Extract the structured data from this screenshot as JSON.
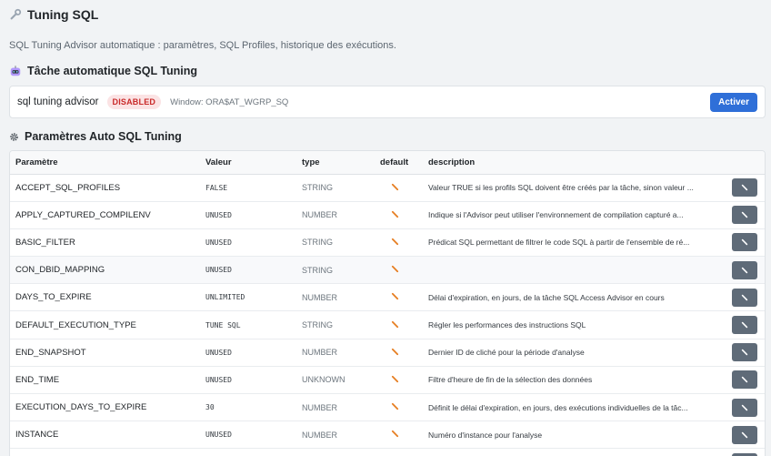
{
  "page": {
    "title": "Tuning SQL",
    "title_icon": "wrench-icon",
    "subtitle": "SQL Tuning Advisor automatique : paramètres, SQL Profiles, historique des exécutions."
  },
  "task_section": {
    "title": "Tâche automatique SQL Tuning",
    "icon": "robot-icon",
    "task_name": "sql tuning advisor",
    "status": "DISABLED",
    "window": "Window: ORA$AT_WGRP_SQ",
    "activate_label": "Activer"
  },
  "params_section": {
    "title": "Paramètres Auto SQL Tuning",
    "icon": "gear-icon",
    "columns": [
      "Paramètre",
      "Valeur",
      "type",
      "default",
      "description"
    ],
    "rows": [
      {
        "name": "ACCEPT_SQL_PROFILES",
        "value": "FALSE",
        "type": "STRING",
        "description": "Valeur TRUE si les profils SQL doivent être créés par la tâche, sinon valeur ..."
      },
      {
        "name": "APPLY_CAPTURED_COMPILENV",
        "value": "UNUSED",
        "type": "NUMBER",
        "description": "Indique si l'Advisor peut utiliser l'environnement de compilation capturé a..."
      },
      {
        "name": "BASIC_FILTER",
        "value": "UNUSED",
        "type": "STRING",
        "description": "Prédicat SQL permettant de filtrer le code SQL à partir de l'ensemble de ré..."
      },
      {
        "name": "CON_DBID_MAPPING",
        "value": "UNUSED",
        "type": "STRING",
        "description": ""
      },
      {
        "name": "DAYS_TO_EXPIRE",
        "value": "UNLIMITED",
        "type": "NUMBER",
        "description": "Délai d'expiration, en jours, de la tâche SQL Access Advisor en cours"
      },
      {
        "name": "DEFAULT_EXECUTION_TYPE",
        "value": "TUNE SQL",
        "type": "STRING",
        "description": "Régler les performances des instructions SQL"
      },
      {
        "name": "END_SNAPSHOT",
        "value": "UNUSED",
        "type": "NUMBER",
        "description": "Dernier ID de cliché pour la période d'analyse"
      },
      {
        "name": "END_TIME",
        "value": "UNUSED",
        "type": "UNKNOWN",
        "description": "Filtre d'heure de fin de la sélection des données"
      },
      {
        "name": "EXECUTION_DAYS_TO_EXPIRE",
        "value": "30",
        "type": "NUMBER",
        "description": "Définit le délai d'expiration, en jours, des exécutions individuelles de la tâc..."
      },
      {
        "name": "INSTANCE",
        "value": "UNUSED",
        "type": "NUMBER",
        "description": "Numéro d'instance pour l'analyse"
      },
      {
        "name": "",
        "value": "",
        "type": "",
        "description": ""
      }
    ]
  },
  "colors": {
    "primary": "#2f6fd8",
    "danger_text": "#c92a2a",
    "danger_bg": "#fbe3e4",
    "edit_button": "#5f6b78",
    "pencil": "#e67e22"
  }
}
